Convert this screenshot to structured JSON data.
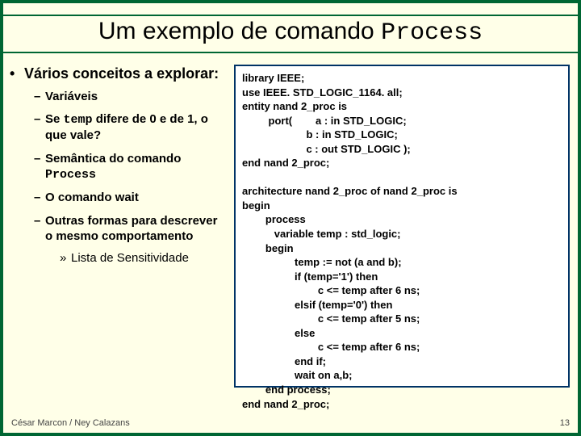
{
  "title_prefix": "Um exemplo de comando ",
  "title_mono": "Process",
  "left": {
    "main": "Vários conceitos a explorar:",
    "items": {
      "i1": "Variáveis",
      "i2a": "Se ",
      "i2mono": "temp",
      "i2b": " difere de 0 e de 1, o que vale?",
      "i3a": "Semântica do comando ",
      "i3mono": "Process",
      "i4": "O comando wait",
      "i5": "Outras formas para descrever o mesmo comportamento",
      "i5sub": "Lista de Sensitividade"
    }
  },
  "code": "library IEEE;\nuse IEEE. STD_LOGIC_1164. all;\nentity nand 2_proc is\n         port(        a : in STD_LOGIC;\n                      b : in STD_LOGIC;\n                      c : out STD_LOGIC );\nend nand 2_proc;\n\narchitecture nand 2_proc of nand 2_proc is\nbegin\n        process\n           variable temp : std_logic;\n        begin\n                  temp := not (a and b);\n                  if (temp='1') then\n                          c <= temp after 6 ns;\n                  elsif (temp='0') then\n                          c <= temp after 5 ns;\n                  else\n                          c <= temp after 6 ns;\n                  end if;\n                  wait on a,b;\n        end process;\nend nand 2_proc;",
  "footer": {
    "authors": "César Marcon / Ney Calazans",
    "page": "13"
  }
}
